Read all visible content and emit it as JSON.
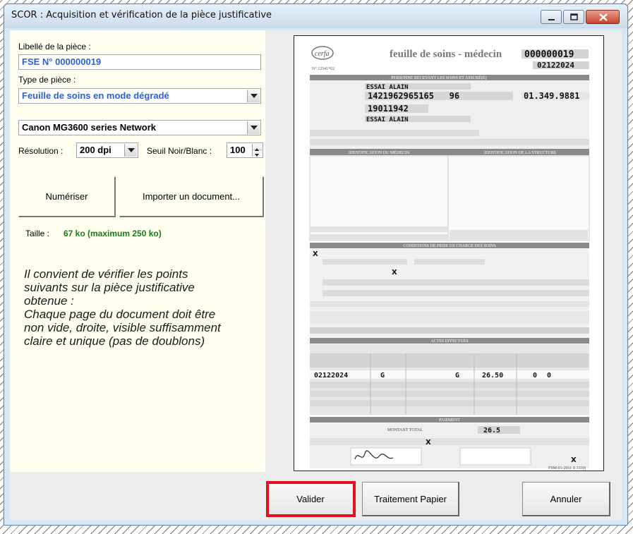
{
  "window": {
    "title": "SCOR : Acquisition et vérification de la pièce justificative"
  },
  "form": {
    "piece_label": "Libellé de la pièce :",
    "piece_value": "FSE N° 000000019",
    "type_label": "Type de pièce :",
    "type_value": "Feuille de soins en mode dégradé",
    "scanner_value": "Canon MG3600 series Network",
    "resolution_label": "Résolution :",
    "resolution_value": "200 dpi",
    "threshold_label": "Seuil  Noir/Blanc :",
    "threshold_value": "100",
    "scan_button": "Numériser",
    "import_button": "Importer un document...",
    "size_label": "Taille :",
    "size_value": "67 ko (maximum 250 ko)",
    "advice": "Il convient de vérifier les points\nsuivants sur la pièce justificative\nobtenue :\nChaque page du document doit être\nnon vide, droite, visible suffisamment\nclaire et unique (pas de doublons)"
  },
  "document": {
    "logo": "cerfa",
    "heading": "feuille de soins - médecin",
    "form_number": "N° 12541*02",
    "invoice_number": "000000019",
    "invoice_date": "02122024",
    "section_patient": "PERSONNE RECEVANT LES SOINS ET ASSURÉ(E)",
    "patient_name": "ESSAI ALAIN",
    "ss_number": "1421962965165   96",
    "birth_date": "19011942",
    "insured_name": "ESSAI ALAIN",
    "fund_code": "01.349.9881",
    "section_doctor": "IDENTIFICATION DU MÉDECIN",
    "section_structure": "IDENTIFICATION DE LA STRUCTURE",
    "section_conditions": "CONDITIONS DE PRISE EN CHARGE DES SOINS",
    "section_acts": "ACTES EFFECTUÉS",
    "act_date": "02122024",
    "act_code": "G",
    "act_code_2": "G",
    "act_amount": "26.50",
    "act_zero_1": "0",
    "act_zero_2": "0",
    "section_payment": "PAIEMENT",
    "total_label": "MONTANT TOTAL",
    "total_amount": "26.5",
    "check_mark": "X",
    "footer_code": "FSM 01-2011   S 3110j"
  },
  "footer": {
    "validate_button": "Valider",
    "paper_button": "Traitement Papier",
    "cancel_button": "Annuler"
  },
  "colors": {
    "accent_blue": "#2b62d4",
    "size_green": "#1a7a1a",
    "highlight_red": "#e1121b"
  }
}
